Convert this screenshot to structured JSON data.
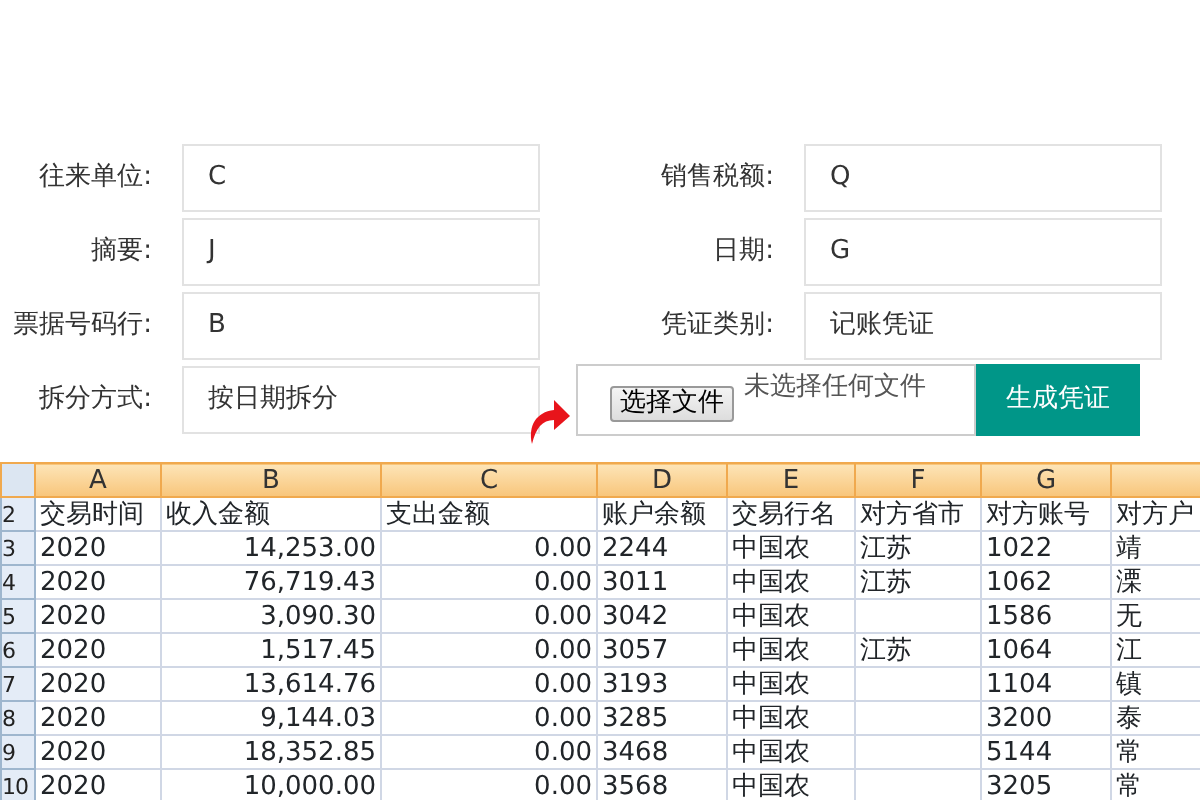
{
  "form": {
    "left_fields": [
      {
        "label": "往来单位:",
        "value": "C"
      },
      {
        "label": "摘要:",
        "value": "J"
      },
      {
        "label": "票据号码行:",
        "value": "B"
      }
    ],
    "right_fields": [
      {
        "label": "销售税额:",
        "value": "Q"
      },
      {
        "label": "日期:",
        "value": "G"
      },
      {
        "label": "凭证类别:",
        "value": "记账凭证"
      }
    ],
    "split_method": {
      "label": "拆分方式:",
      "value": "按日期拆分"
    },
    "file_input": {
      "button": "选择文件",
      "status": "未选择任何文件"
    },
    "generate_button": "生成凭证"
  },
  "sheet": {
    "columns": [
      "A",
      "B",
      "C",
      "D",
      "E",
      "F",
      "G",
      ""
    ],
    "rows": [
      {
        "number": "2",
        "cells": [
          "交易时间",
          "收入金额",
          "支出金额",
          "账户余额",
          "交易行名",
          "对方省市",
          "对方账号",
          "对方户"
        ]
      },
      {
        "number": "3",
        "cells": [
          "2020",
          "14,253.00",
          "0.00",
          "2244",
          "中国农",
          "江苏",
          "1022",
          "靖"
        ]
      },
      {
        "number": "4",
        "cells": [
          "2020",
          "76,719.43",
          "0.00",
          "3011",
          "中国农",
          "江苏",
          "1062",
          "溧"
        ]
      },
      {
        "number": "5",
        "cells": [
          "2020",
          "3,090.30",
          "0.00",
          "3042",
          "中国农",
          "",
          "1586",
          "无"
        ]
      },
      {
        "number": "6",
        "cells": [
          "2020",
          "1,517.45",
          "0.00",
          "3057",
          "中国农",
          "江苏",
          "1064",
          "江"
        ]
      },
      {
        "number": "7",
        "cells": [
          "2020",
          "13,614.76",
          "0.00",
          "3193",
          "中国农",
          "",
          "1104",
          "镇"
        ]
      },
      {
        "number": "8",
        "cells": [
          "2020",
          "9,144.03",
          "0.00",
          "3285",
          "中国农",
          "",
          "3200",
          "泰"
        ]
      },
      {
        "number": "9",
        "cells": [
          "2020",
          "18,352.85",
          "0.00",
          "3468",
          "中国农",
          "",
          "5144",
          "常"
        ]
      },
      {
        "number": "10",
        "cells": [
          "2020",
          "10,000.00",
          "0.00",
          "3568",
          "中国农",
          "",
          "3205",
          "常"
        ]
      }
    ]
  }
}
